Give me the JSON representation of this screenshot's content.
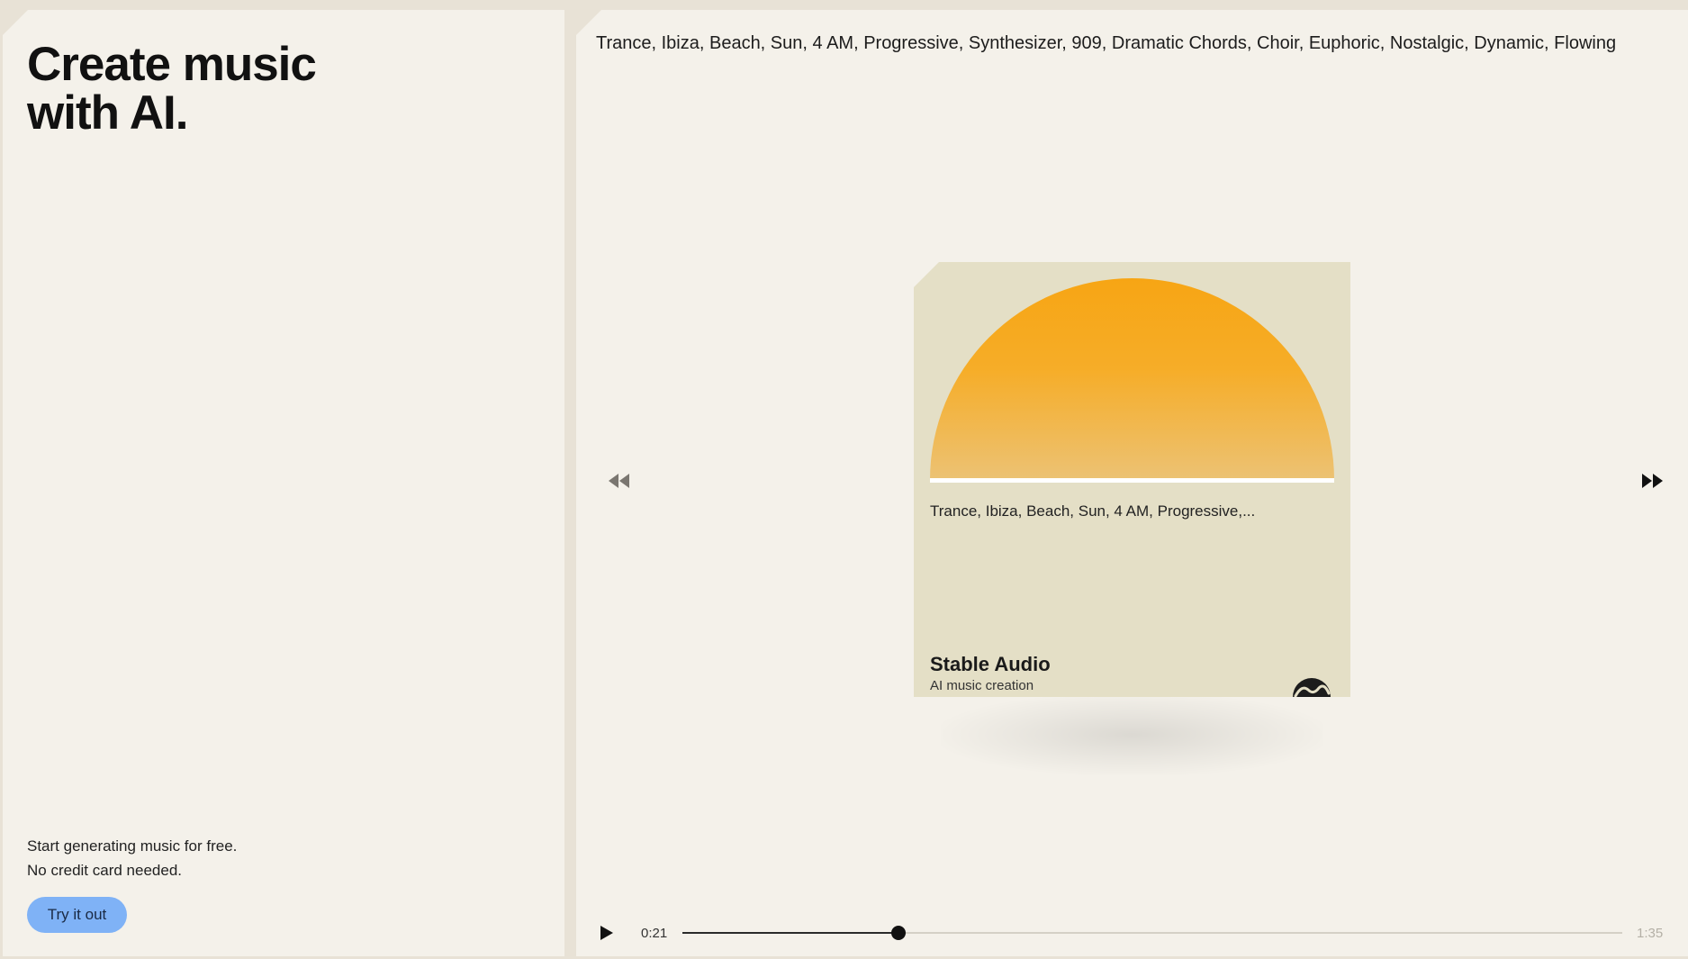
{
  "hero": {
    "line1": "Create music",
    "line2": "with AI."
  },
  "promo": {
    "line1": "Start generating music for free.",
    "line2": "No credit card needed.",
    "cta_label": "Try it out"
  },
  "prompt": {
    "text": "Trance, Ibiza, Beach, Sun, 4 AM, Progressive, Synthesizer, 909, Dramatic Chords, Choir, Euphoric, Nostalgic, Dynamic, Flowing"
  },
  "card": {
    "caption": "Trance, Ibiza, Beach, Sun, 4 AM, Progressive,...",
    "title": "Stable Audio",
    "subtitle": "AI music creation"
  },
  "player": {
    "current_time": "0:21",
    "total_time": "1:35",
    "progress": 0.23
  },
  "icons": {
    "prev": "rewind-icon",
    "next": "fast-forward-icon",
    "play": "play-icon",
    "logo": "stable-audio-logo-icon"
  },
  "colors": {
    "page_bg": "#e8e2d6",
    "panel_bg": "#f4f1ea",
    "card_bg": "#e4dfc6",
    "sun_top": "#f7a514",
    "sun_bottom": "#ecc274",
    "cta_bg": "#7fb2f6"
  }
}
